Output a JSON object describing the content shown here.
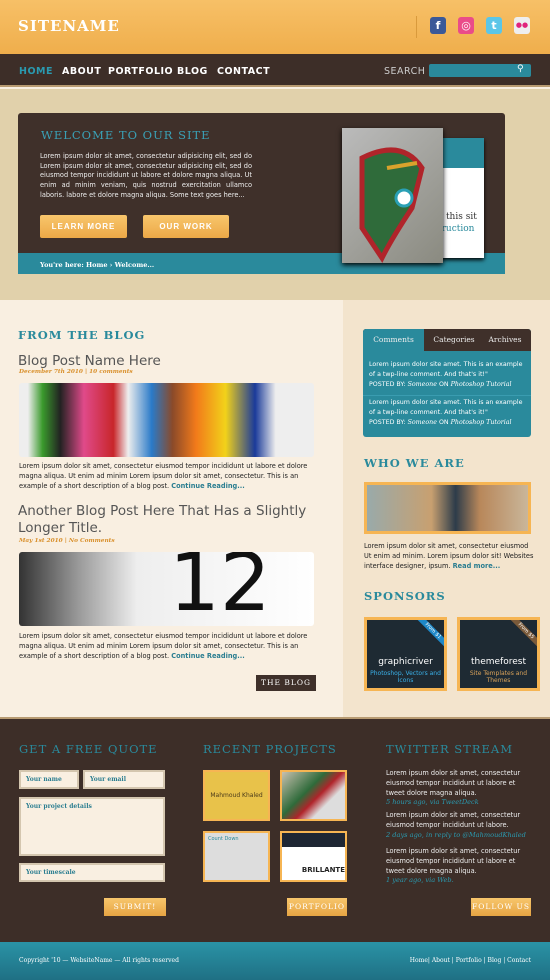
{
  "header": {
    "sitename": "SITENAME",
    "social": [
      {
        "icon": "facebook-icon",
        "glyph": "f",
        "color": "#3b5998"
      },
      {
        "icon": "dribbble-icon",
        "glyph": "◎",
        "color": "#ea4c89"
      },
      {
        "icon": "twitter-icon",
        "glyph": "t",
        "color": "#5bc6e8"
      },
      {
        "icon": "flickr-icon",
        "glyph": "●●",
        "color": "#eeeeee"
      }
    ]
  },
  "nav": {
    "items": [
      "HOME",
      "ABOUT",
      "PORTFOLIO",
      "BLOG",
      "CONTACT"
    ],
    "active": "HOME",
    "search_label": "SEARCH",
    "search_value": ""
  },
  "hero": {
    "title": "WELCOME TO OUR SITE",
    "text": "Lorem ipsum dolor sit amet, consectetur adipisicing elit, sed do Lorem ipsum dolor sit amet, consectetur adipisicing elit, sed do eiusmod tempor incididunt ut labore et dolore magna aliqua. Ut enim ad minim veniam, quis nostrud exercitation ullamco laboris. labore et dolore magna aliqua. Some text goes here...",
    "learn_more": "LEARN MORE",
    "our_work": "OUR WORK",
    "breadcrumb": "You're here: Home › Welcome...",
    "card_text_1": "y this sit",
    "card_text_2": "truction"
  },
  "blog": {
    "heading": "FROM THE BLOG",
    "posts": [
      {
        "title": "Blog Post Name Here",
        "meta": "December 7th 2010 | 10 comments",
        "text": "Lorem ipsum dolor sit amet, consectetur eiusmod tempor incididunt ut labore et dolore magna aliqua. Ut enim ad minim Lorem ipsum dolor sit amet, consectetur. This is an example of a short description of a blog post.",
        "more": "Continue Reading..."
      },
      {
        "title": "Another Blog Post Here That Has a Slightly Longer Title.",
        "meta": "May 1st 2010 | No Comments",
        "text": "Lorem ipsum dolor sit amet, consectetur eiusmod tempor incididunt ut labore et dolore magna aliqua. Ut enim ad minim Lorem ipsum dolor sit amet, consectetur. This is an example of a short description of a blog post.",
        "more": "Continue Reading..."
      }
    ],
    "button": "THE BLOG"
  },
  "sidebar": {
    "tabs": [
      "Comments",
      "Categories",
      "Archives"
    ],
    "comments": [
      {
        "text": "Lorem ipsum dolor site amet. This is an example of a twp-line comment. And that's it!\"",
        "posted_by": "POSTED BY:",
        "author": "Someone",
        "on": "ON",
        "where": "Photoshop Tutorial"
      },
      {
        "text": "Lorem ipsum dolor site amet. This is an example of a twp-line comment. And that's it!\"",
        "posted_by": "POSTED BY:",
        "author": "Someone",
        "on": "ON",
        "where": "Photoshop Tutorial"
      }
    ],
    "who_heading": "WHO WE ARE",
    "who_text": "Lorem ipsum dolor sit amet, consectetur eiusmod Ut enim ad minim. Lorem ipsum dolor sit! Websites interface designer, ipsum.",
    "who_more": "Read more...",
    "sponsors_heading": "SPONSORS",
    "sponsors": [
      {
        "name": "graphicriver",
        "sub": "Photoshop, Vectors and Icons",
        "ribbon": "From $1"
      },
      {
        "name": "themeforest",
        "sub": "Site Templates and Themes",
        "ribbon": "From $5"
      }
    ]
  },
  "footer": {
    "quote_heading": "GET A FREE QUOTE",
    "name_placeholder": "Your name",
    "email_placeholder": "Your email",
    "details_placeholder": "Your project details",
    "timescale_placeholder": "Your timescale",
    "submit": "SUBMIT!",
    "projects_heading": "RECENT PROJECTS",
    "projects": [
      "Mahmoud Khaled",
      "",
      "Count Down",
      "BRILLANTE"
    ],
    "portfolio": "PORTFOLIO",
    "twitter_heading": "TWITTER STREAM",
    "tweets": [
      {
        "text": "Lorem ipsum dolor sit amet, consectetur eiusmod tempor incididunt ut labore et tweet dolore magna aliqua.",
        "meta": "5 hours ago, via TweetDeck"
      },
      {
        "text": "Lorem ipsum dolor sit amet, consectetur eiusmod tempor incididunt ut labore.",
        "meta": "2 days ago, in reply to @MahmoudKhaled"
      },
      {
        "text": "Lorem ipsum dolor sit amet, consectetur eiusmod tempor incididunt ut labore et tweet dolore magna aliqua.",
        "meta": "1 year ago, via Web."
      }
    ],
    "follow": "FOLLOW US",
    "copyright": "Copyright '10 — WebsiteName — All rights reserved",
    "links": [
      "Home",
      "About",
      "Portfolio",
      "Blog",
      "Contact"
    ]
  }
}
